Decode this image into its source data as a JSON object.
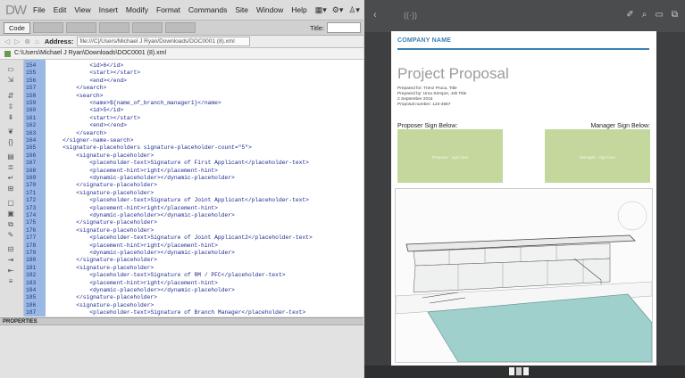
{
  "editor": {
    "logo": "DW",
    "menu": [
      "File",
      "Edit",
      "View",
      "Insert",
      "Modify",
      "Format",
      "Commands",
      "Site",
      "Window",
      "Help"
    ],
    "toolbar": {
      "code_label": "Code",
      "title_label": "Title:"
    },
    "address": {
      "label": "Address:",
      "value": "file:///C|/Users/Michael J Ryan/Downloads/DOC0001 (8).xml"
    },
    "file_path": "C:\\Users\\Michael J Ryan\\Downloads\\DOC0001 (8).xml",
    "code_lines": [
      {
        "num": "154",
        "text": "            <id>6</id>"
      },
      {
        "num": "155",
        "text": "            <start></start>"
      },
      {
        "num": "156",
        "text": "            <end></end>"
      },
      {
        "num": "157",
        "text": "        </search>"
      },
      {
        "num": "158",
        "text": "        <search>"
      },
      {
        "num": "159",
        "text": "            <name>${name_of_branch_manager1}</name>"
      },
      {
        "num": "160",
        "text": "            <id>5</id>"
      },
      {
        "num": "161",
        "text": "            <start></start>"
      },
      {
        "num": "162",
        "text": "            <end></end>"
      },
      {
        "num": "163",
        "text": "        </search>"
      },
      {
        "num": "164",
        "text": "    </signer-name-search>"
      },
      {
        "num": "165",
        "text": "    <signature-placeholders signature-placeholder-count=\"5\">"
      },
      {
        "num": "166",
        "text": "        <signature-placeholder>"
      },
      {
        "num": "167",
        "text": "            <placeholder-text>Signature of First Applicant</placeholder-text>"
      },
      {
        "num": "168",
        "text": "            <placement-hint>right</placement-hint>"
      },
      {
        "num": "169",
        "text": "            <dynamic-placeholder></dynamic-placeholder>"
      },
      {
        "num": "170",
        "text": "        </signature-placeholder>"
      },
      {
        "num": "171",
        "text": "        <signature-placeholder>"
      },
      {
        "num": "172",
        "text": "            <placeholder-text>Signature of Joint Applicant</placeholder-text>"
      },
      {
        "num": "173",
        "text": "            <placement-hint>right</placement-hint>"
      },
      {
        "num": "174",
        "text": "            <dynamic-placeholder></dynamic-placeholder>"
      },
      {
        "num": "175",
        "text": "        </signature-placeholder>"
      },
      {
        "num": "176",
        "text": "        <signature-placeholder>"
      },
      {
        "num": "177",
        "text": "            <placeholder-text>Signature of Joint Applicant2</placeholder-text>"
      },
      {
        "num": "178",
        "text": "            <placement-hint>right</placement-hint>"
      },
      {
        "num": "179",
        "text": "            <dynamic-placeholder></dynamic-placeholder>"
      },
      {
        "num": "180",
        "text": "        </signature-placeholder>"
      },
      {
        "num": "181",
        "text": "        <signature-placeholder>"
      },
      {
        "num": "182",
        "text": "            <placeholder-text>Signature of RM / PFC</placeholder-text>"
      },
      {
        "num": "183",
        "text": "            <placement-hint>right</placement-hint>"
      },
      {
        "num": "184",
        "text": "            <dynamic-placeholder></dynamic-placeholder>"
      },
      {
        "num": "185",
        "text": "        </signature-placeholder>"
      },
      {
        "num": "186",
        "text": "        <signature-placeholder>"
      },
      {
        "num": "187",
        "text": "            <placeholder-text>Signature of Branch Manager</placeholder-text>"
      }
    ],
    "properties_label": "PROPERTIES"
  },
  "viewer": {
    "document": {
      "company": "COMPANY NAME",
      "title": "Project Proposal",
      "meta": [
        "Prepared for: Trenz Pruca, Title",
        "Prepared by: Uma Sempor, Job Title",
        "2 September 2015",
        "Proposal number: 123-4567"
      ],
      "proposer_label": "Proposer Sign Below:",
      "manager_label": "Manager Sign Below:",
      "proposer_box_text": "Proposer · sign here",
      "manager_box_text": "Manager · sign here"
    },
    "colors": {
      "sign_box": "#c4d79c",
      "company": "#3b7fb3"
    }
  }
}
